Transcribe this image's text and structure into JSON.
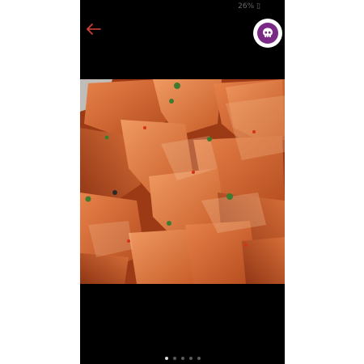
{
  "status_bar": {
    "text": "26% ▯"
  },
  "header": {
    "back_icon": "arrow-left-icon",
    "avatar_icon": "skull-icon",
    "accent_color": "#d9443a",
    "avatar_color": "#7a2a86"
  },
  "gallery": {
    "dots": 5,
    "active_index": 0
  }
}
